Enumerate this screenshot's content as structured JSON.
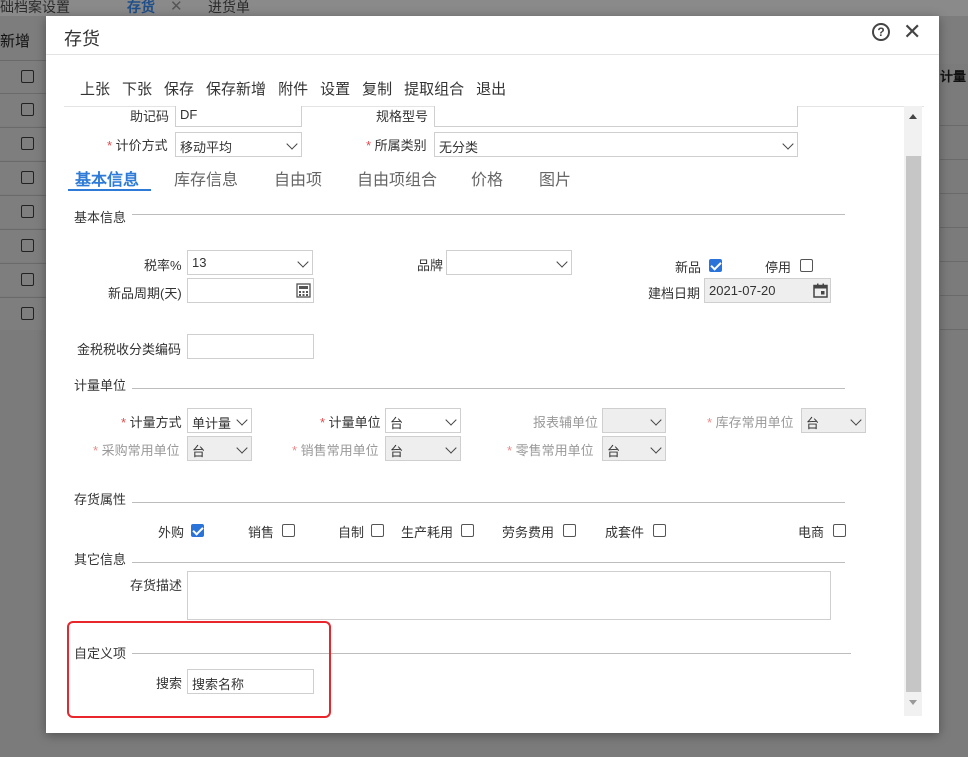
{
  "background": {
    "tabs": [
      "础档案设置",
      "存货",
      "进货单"
    ],
    "new_label": "新增",
    "right_header": "计量"
  },
  "dialog": {
    "title": "存货",
    "help_icon": "question-circle-icon",
    "close_icon": "close-icon",
    "menu": [
      "上张",
      "下张",
      "保存",
      "保存新增",
      "附件",
      "设置",
      "复制",
      "提取组合",
      "退出"
    ]
  },
  "top_fields": {
    "mnemonic_label": "助记码",
    "mnemonic_value": "DF",
    "spec_label": "规格型号",
    "spec_value": "",
    "pricing_label": "计价方式",
    "pricing_value": "移动平均",
    "category_label": "所属类别",
    "category_value": "无分类"
  },
  "tabs": [
    "基本信息",
    "库存信息",
    "自由项",
    "自由项组合",
    "价格",
    "图片"
  ],
  "basic_info": {
    "section_title": "基本信息",
    "tax_rate_label": "税率%",
    "tax_rate_value": "13",
    "brand_label": "品牌",
    "brand_value": "",
    "new_product_label": "新品",
    "new_product_checked": true,
    "disabled_label": "停用",
    "disabled_checked": false,
    "new_period_label": "新品周期(天)",
    "new_period_value": "",
    "created_date_label": "建档日期",
    "created_date_value": "2021-07-20",
    "tax_code_label": "金税税收分类编码",
    "tax_code_value": ""
  },
  "units": {
    "section_title": "计量单位",
    "method_label": "计量方式",
    "method_value": "单计量",
    "unit_label": "计量单位",
    "unit_value": "台",
    "report_unit_label": "报表辅单位",
    "report_unit_value": "",
    "stock_unit_label": "库存常用单位",
    "stock_unit_value": "台",
    "purchase_unit_label": "采购常用单位",
    "purchase_unit_value": "台",
    "sales_unit_label": "销售常用单位",
    "sales_unit_value": "台",
    "retail_unit_label": "零售常用单位",
    "retail_unit_value": "台"
  },
  "attributes": {
    "section_title": "存货属性",
    "items": [
      {
        "label": "外购",
        "checked": true
      },
      {
        "label": "销售",
        "checked": false
      },
      {
        "label": "自制",
        "checked": false
      },
      {
        "label": "生产耗用",
        "checked": false
      },
      {
        "label": "劳务费用",
        "checked": false
      },
      {
        "label": "成套件",
        "checked": false
      },
      {
        "label": "电商",
        "checked": false
      }
    ]
  },
  "other": {
    "section_title": "其它信息",
    "desc_label": "存货描述",
    "desc_value": ""
  },
  "custom": {
    "section_title": "自定义项",
    "search_label": "搜索",
    "search_value": "搜索名称"
  },
  "colors": {
    "accent": "#2d7bd6",
    "required": "#e24a4a",
    "highlight_box": "#e8262b"
  }
}
